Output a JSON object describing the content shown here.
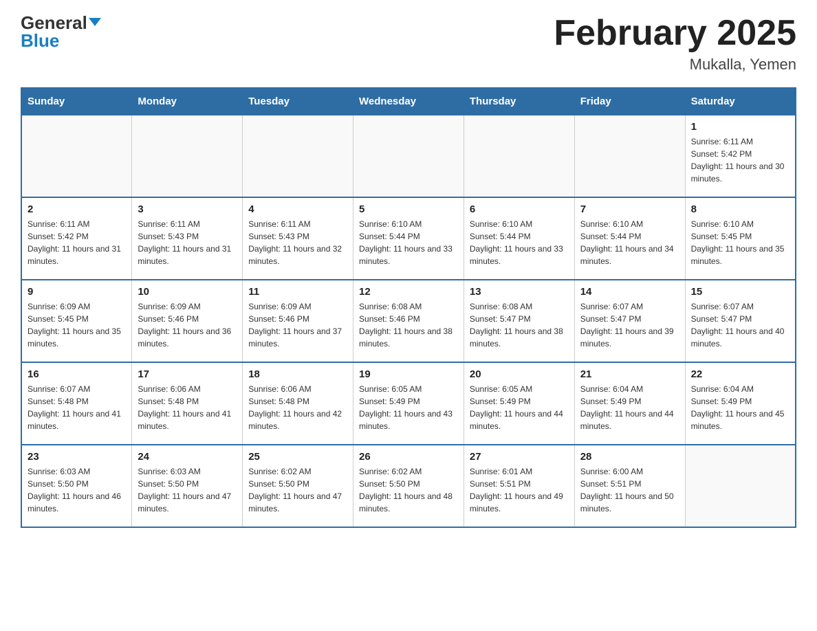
{
  "header": {
    "logo_general": "General",
    "logo_blue": "Blue",
    "month_title": "February 2025",
    "location": "Mukalla, Yemen"
  },
  "weekdays": [
    "Sunday",
    "Monday",
    "Tuesday",
    "Wednesday",
    "Thursday",
    "Friday",
    "Saturday"
  ],
  "weeks": [
    [
      {
        "day": "",
        "info": ""
      },
      {
        "day": "",
        "info": ""
      },
      {
        "day": "",
        "info": ""
      },
      {
        "day": "",
        "info": ""
      },
      {
        "day": "",
        "info": ""
      },
      {
        "day": "",
        "info": ""
      },
      {
        "day": "1",
        "info": "Sunrise: 6:11 AM\nSunset: 5:42 PM\nDaylight: 11 hours and 30 minutes."
      }
    ],
    [
      {
        "day": "2",
        "info": "Sunrise: 6:11 AM\nSunset: 5:42 PM\nDaylight: 11 hours and 31 minutes."
      },
      {
        "day": "3",
        "info": "Sunrise: 6:11 AM\nSunset: 5:43 PM\nDaylight: 11 hours and 31 minutes."
      },
      {
        "day": "4",
        "info": "Sunrise: 6:11 AM\nSunset: 5:43 PM\nDaylight: 11 hours and 32 minutes."
      },
      {
        "day": "5",
        "info": "Sunrise: 6:10 AM\nSunset: 5:44 PM\nDaylight: 11 hours and 33 minutes."
      },
      {
        "day": "6",
        "info": "Sunrise: 6:10 AM\nSunset: 5:44 PM\nDaylight: 11 hours and 33 minutes."
      },
      {
        "day": "7",
        "info": "Sunrise: 6:10 AM\nSunset: 5:44 PM\nDaylight: 11 hours and 34 minutes."
      },
      {
        "day": "8",
        "info": "Sunrise: 6:10 AM\nSunset: 5:45 PM\nDaylight: 11 hours and 35 minutes."
      }
    ],
    [
      {
        "day": "9",
        "info": "Sunrise: 6:09 AM\nSunset: 5:45 PM\nDaylight: 11 hours and 35 minutes."
      },
      {
        "day": "10",
        "info": "Sunrise: 6:09 AM\nSunset: 5:46 PM\nDaylight: 11 hours and 36 minutes."
      },
      {
        "day": "11",
        "info": "Sunrise: 6:09 AM\nSunset: 5:46 PM\nDaylight: 11 hours and 37 minutes."
      },
      {
        "day": "12",
        "info": "Sunrise: 6:08 AM\nSunset: 5:46 PM\nDaylight: 11 hours and 38 minutes."
      },
      {
        "day": "13",
        "info": "Sunrise: 6:08 AM\nSunset: 5:47 PM\nDaylight: 11 hours and 38 minutes."
      },
      {
        "day": "14",
        "info": "Sunrise: 6:07 AM\nSunset: 5:47 PM\nDaylight: 11 hours and 39 minutes."
      },
      {
        "day": "15",
        "info": "Sunrise: 6:07 AM\nSunset: 5:47 PM\nDaylight: 11 hours and 40 minutes."
      }
    ],
    [
      {
        "day": "16",
        "info": "Sunrise: 6:07 AM\nSunset: 5:48 PM\nDaylight: 11 hours and 41 minutes."
      },
      {
        "day": "17",
        "info": "Sunrise: 6:06 AM\nSunset: 5:48 PM\nDaylight: 11 hours and 41 minutes."
      },
      {
        "day": "18",
        "info": "Sunrise: 6:06 AM\nSunset: 5:48 PM\nDaylight: 11 hours and 42 minutes."
      },
      {
        "day": "19",
        "info": "Sunrise: 6:05 AM\nSunset: 5:49 PM\nDaylight: 11 hours and 43 minutes."
      },
      {
        "day": "20",
        "info": "Sunrise: 6:05 AM\nSunset: 5:49 PM\nDaylight: 11 hours and 44 minutes."
      },
      {
        "day": "21",
        "info": "Sunrise: 6:04 AM\nSunset: 5:49 PM\nDaylight: 11 hours and 44 minutes."
      },
      {
        "day": "22",
        "info": "Sunrise: 6:04 AM\nSunset: 5:49 PM\nDaylight: 11 hours and 45 minutes."
      }
    ],
    [
      {
        "day": "23",
        "info": "Sunrise: 6:03 AM\nSunset: 5:50 PM\nDaylight: 11 hours and 46 minutes."
      },
      {
        "day": "24",
        "info": "Sunrise: 6:03 AM\nSunset: 5:50 PM\nDaylight: 11 hours and 47 minutes."
      },
      {
        "day": "25",
        "info": "Sunrise: 6:02 AM\nSunset: 5:50 PM\nDaylight: 11 hours and 47 minutes."
      },
      {
        "day": "26",
        "info": "Sunrise: 6:02 AM\nSunset: 5:50 PM\nDaylight: 11 hours and 48 minutes."
      },
      {
        "day": "27",
        "info": "Sunrise: 6:01 AM\nSunset: 5:51 PM\nDaylight: 11 hours and 49 minutes."
      },
      {
        "day": "28",
        "info": "Sunrise: 6:00 AM\nSunset: 5:51 PM\nDaylight: 11 hours and 50 minutes."
      },
      {
        "day": "",
        "info": ""
      }
    ]
  ]
}
